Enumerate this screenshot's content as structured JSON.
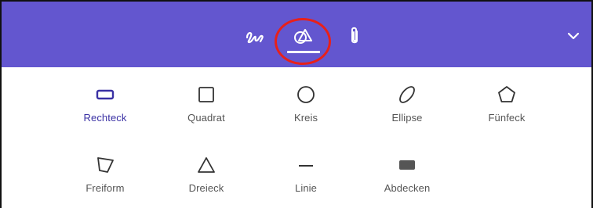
{
  "toolbar": {
    "background_color": "#6356cf",
    "buttons": [
      {
        "icon": "ink-squiggle-icon",
        "active": false
      },
      {
        "icon": "shapes-icon",
        "active": true
      },
      {
        "icon": "paperclip-icon",
        "active": false
      }
    ],
    "collapse_icon": "chevron-down-icon",
    "highlight_color": "#e8201a"
  },
  "shapes": {
    "selected": "Rechteck",
    "accent_color": "#3a31a4",
    "items": [
      {
        "label": "Rechteck",
        "icon": "rectangle-icon"
      },
      {
        "label": "Quadrat",
        "icon": "square-icon"
      },
      {
        "label": "Kreis",
        "icon": "circle-icon"
      },
      {
        "label": "Ellipse",
        "icon": "ellipse-icon"
      },
      {
        "label": "Fünfeck",
        "icon": "pentagon-icon"
      },
      {
        "label": "Freiform",
        "icon": "freeform-icon"
      },
      {
        "label": "Dreieck",
        "icon": "triangle-icon"
      },
      {
        "label": "Linie",
        "icon": "line-icon"
      },
      {
        "label": "Abdecken",
        "icon": "cover-icon"
      }
    ]
  }
}
